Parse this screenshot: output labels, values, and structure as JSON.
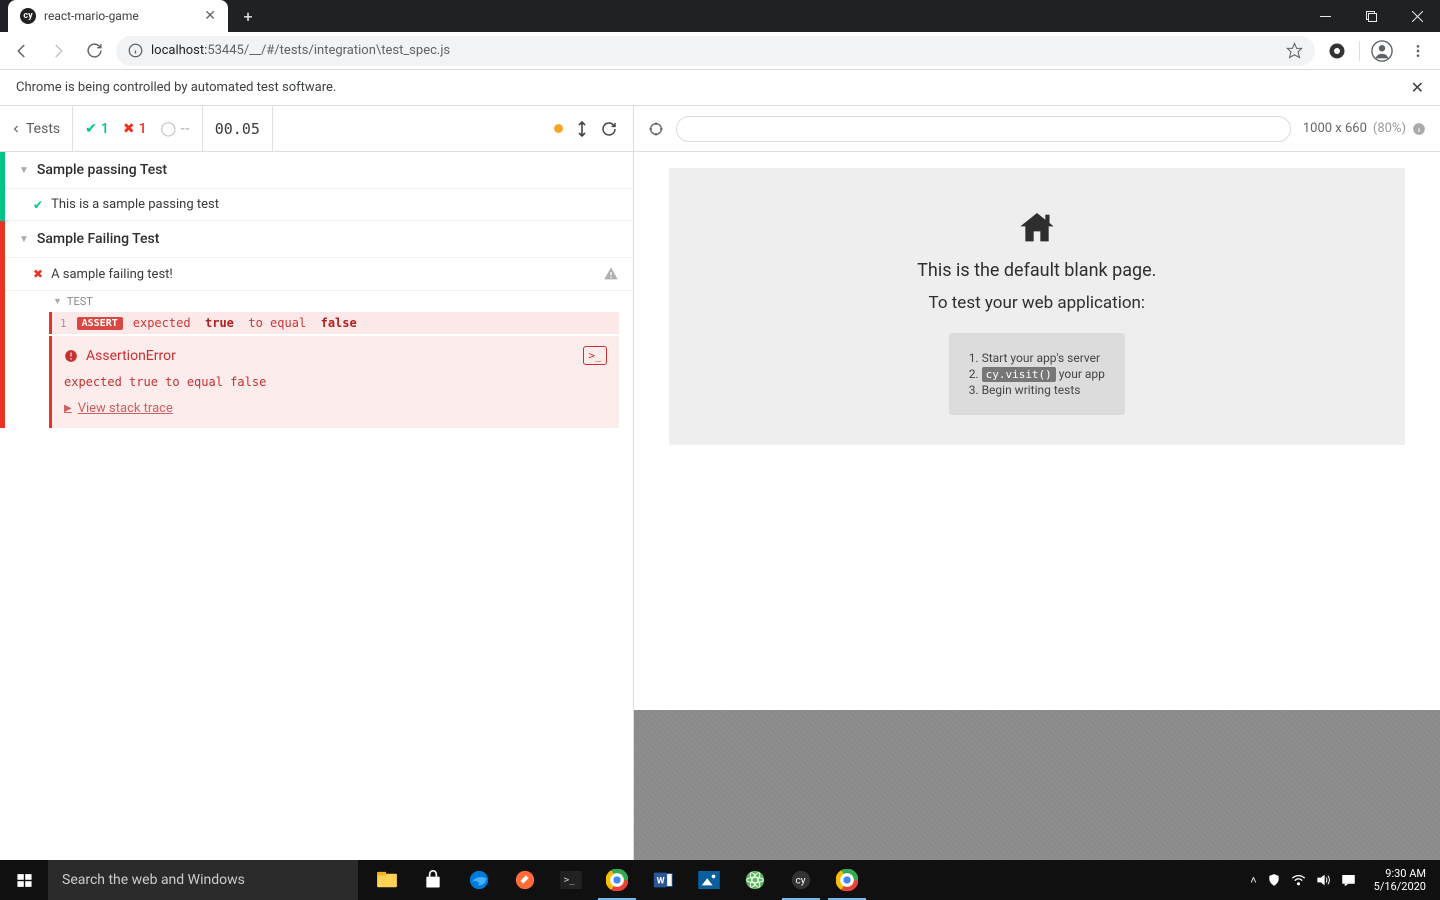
{
  "browser": {
    "tab_title": "react-mario-game",
    "favicon_text": "cy",
    "url_host": "localhost:",
    "url_port_path": "53445/__/#/tests/integration\\test_spec.js",
    "automation_banner": "Chrome is being controlled by automated test software."
  },
  "cypress_header": {
    "tests_label": "Tests",
    "pass_count": "1",
    "fail_count": "1",
    "pending_count": "--",
    "timer": "00.05"
  },
  "suites": {
    "pass_suite_title": "Sample passing Test",
    "pass_test_title": "This is a sample passing test",
    "fail_suite_title": "Sample Failing Test",
    "fail_test_title": "A sample failing test!",
    "sub_label": "TEST",
    "cmd_num": "1",
    "assert_label": "ASSERT",
    "cmd_expected": "expected",
    "cmd_true": "true",
    "cmd_to_equal": "to equal",
    "cmd_false": "false",
    "error_title": "AssertionError",
    "error_message": "expected true to equal false",
    "stack_trace_link": "View stack trace"
  },
  "preview": {
    "viewport_dims": "1000 x 660",
    "viewport_pct": "(80%)",
    "blank_title": "This is the default blank page.",
    "blank_sub": "To test your web application:",
    "step1": "Start your app's server",
    "step2_pre": "",
    "step2_code": "cy.visit()",
    "step2_post": " your app",
    "step3": "Begin writing tests"
  },
  "taskbar": {
    "search_placeholder": "Search the web and Windows",
    "time": "9:30 AM",
    "date": "5/16/2020"
  }
}
